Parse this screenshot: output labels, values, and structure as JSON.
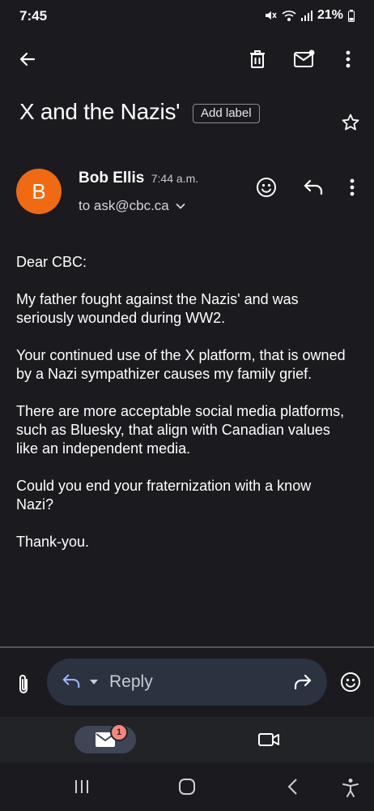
{
  "status_bar": {
    "time": "7:45",
    "battery": "21%",
    "icons": [
      "mute-icon",
      "wifi-icon",
      "signal-icon",
      "battery-icon"
    ]
  },
  "toolbar": {
    "icons": [
      "back-arrow-icon",
      "trash-icon",
      "mark-unread-icon",
      "more-vert-icon"
    ]
  },
  "email": {
    "subject": "X and the Nazis'",
    "add_label": "Add label",
    "sender": {
      "initial": "B",
      "name": "Bob Ellis",
      "time": "7:44 a.m.",
      "recipient": "to ask@cbc.ca",
      "avatar_color": "#f06a12"
    },
    "body": [
      "Dear CBC:",
      "My father fought against the Nazis' and was seriously wounded during WW2.",
      "Your continued use of the X platform, that is owned by a Nazi sympathizer causes my family grief.",
      "There are more acceptable social media platforms, such as Bluesky, that align with Canadian values like an independent media.",
      "Could you end your fraternization with a know Nazi?",
      "Thank-you."
    ]
  },
  "compose": {
    "reply_label": "Reply"
  },
  "bottom_nav": {
    "mail_badge": "1",
    "items": [
      "mail-icon",
      "video-camera-icon"
    ]
  },
  "system_nav": {
    "items": [
      "recents-icon",
      "home-icon",
      "back-icon",
      "accessibility-icon"
    ]
  },
  "colors": {
    "background": "#1b1b1f",
    "reply_bar": "#2b3240",
    "nav_pill": "#3e4656",
    "badge": "#f08a7c"
  }
}
